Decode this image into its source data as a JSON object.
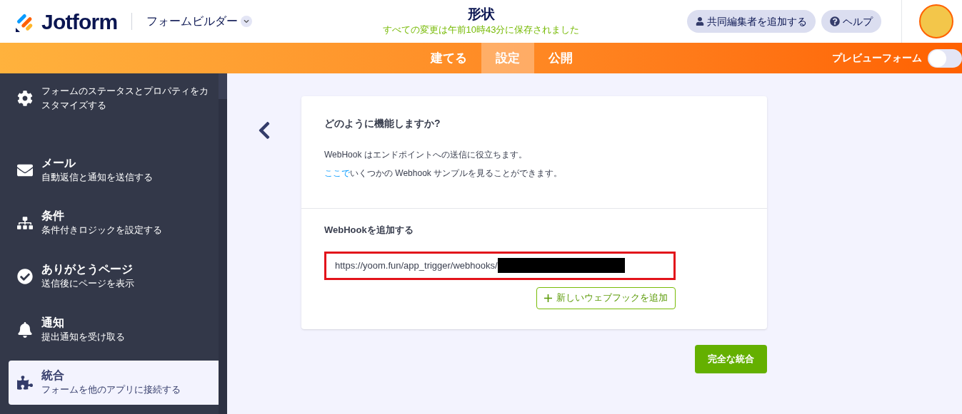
{
  "header": {
    "logo": "Jotform",
    "builder_menu": "フォームビルダー",
    "title": "形状",
    "save_status": "すべての変更は午前10時43分に保存されました",
    "invite_button": "共同編集者を追加する",
    "help_button": "ヘルプ"
  },
  "nav": {
    "tabs": [
      {
        "label": "建てる",
        "selected": false
      },
      {
        "label": "設定",
        "selected": true
      },
      {
        "label": "公開",
        "selected": false
      }
    ],
    "preview": {
      "label": "プレビューフォーム",
      "on": false
    }
  },
  "sidebar": {
    "items": [
      {
        "description": "フォームのステータスとプロパティをカスタマイズする",
        "selected": false
      },
      {
        "title": "メール",
        "description": "自動返信と通知を送信する",
        "selected": false
      },
      {
        "title": "条件",
        "description": "条件付きロジックを設定する",
        "selected": false
      },
      {
        "title": "ありがとうページ",
        "description": "送信後にページを表示",
        "selected": false
      },
      {
        "title": "通知",
        "description": "提出通知を受け取る",
        "selected": false
      },
      {
        "title": "統合",
        "description": "フォームを他のアプリに接続する",
        "selected": true
      }
    ]
  },
  "panel": {
    "heading": "どのように機能しますか?",
    "text": "WebHook はエンドポイントへの送信に役立ちます。",
    "link": "ここで",
    "link_rest": "いくつかの Webhook サンプルを見ることができます。",
    "add_heading": "WebHookを追加する",
    "webhook_url": "https://yoom.fun/app_trigger/webhooks/",
    "add_button": "新しいウェブフックを追加",
    "complete_button": "完全な統合"
  }
}
